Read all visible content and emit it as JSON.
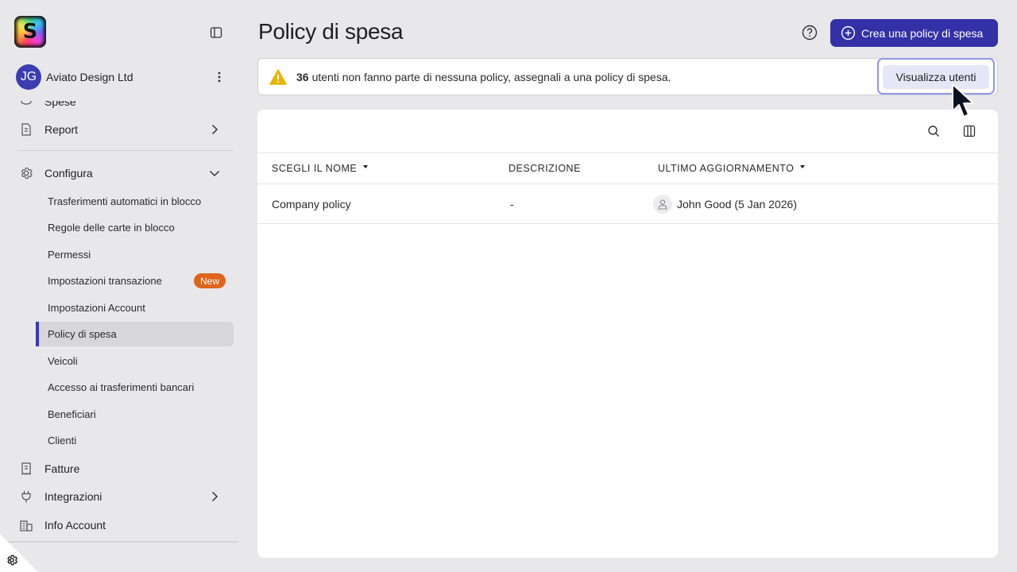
{
  "sidebar": {
    "org_initials": "JG",
    "org_name": "Aviato Design Ltd",
    "partial_item_label": "Spese",
    "items": {
      "report": "Report",
      "configura": "Configura",
      "fatture": "Fatture",
      "integrazioni": "Integrazioni",
      "info_account": "Info Account"
    },
    "sub_items": [
      "Trasferimenti automatici in blocco",
      "Regole delle carte in blocco",
      "Permessi",
      "Impostazioni transazione",
      "Impostazioni Account",
      "Policy di spesa",
      "Veicoli",
      "Accesso ai trasferimenti bancari",
      "Beneficiari",
      "Clienti"
    ],
    "new_badge": "New",
    "active_sub_item": "Policy di spesa"
  },
  "header": {
    "title": "Policy di spesa",
    "create_button": "Crea una policy di spesa"
  },
  "alert": {
    "count": "36",
    "message": "utenti non fanno parte di nessuna policy, assegnali a una policy di spesa.",
    "button": "Visualizza utenti"
  },
  "table": {
    "columns": [
      "SCEGLI IL NOME",
      "DESCRIZIONE",
      "ULTIMO AGGIORNAMENTO"
    ],
    "rows": [
      {
        "name": "Company policy",
        "description": "-",
        "updated": "John Good (5 Jan 2026)"
      }
    ]
  },
  "colors": {
    "accent": "#3431a8",
    "badge": "#e0641b",
    "warning": "#e8b400"
  }
}
